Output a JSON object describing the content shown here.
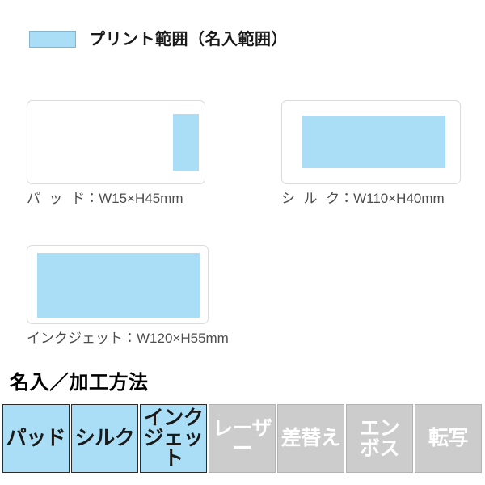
{
  "legend": {
    "swatch_color": "#aadef7",
    "label": "プリント範囲（名入範囲）"
  },
  "print_areas": [
    {
      "id": "pad",
      "method_jp": "パッド",
      "caption": "パッド：W15×H45mm",
      "dimension_text": "W15×H45mm",
      "width_mm": 15,
      "height_mm": 45
    },
    {
      "id": "silk",
      "method_jp": "シルク",
      "caption": "シルク：W110×H40mm",
      "dimension_text": "W110×H40mm",
      "width_mm": 110,
      "height_mm": 40
    },
    {
      "id": "inkjet",
      "method_jp": "インクジェット",
      "caption": "インクジェット：W120×H55mm",
      "dimension_text": "W120×H55mm",
      "width_mm": 120,
      "height_mm": 55
    }
  ],
  "methods": {
    "heading": "名入／加工方法",
    "active_color": "#aadef7",
    "disabled_color": "#cccccc",
    "items": [
      {
        "label": "パッド",
        "available": true,
        "lines": [
          "パッド"
        ]
      },
      {
        "label": "シルク",
        "available": true,
        "lines": [
          "シルク"
        ]
      },
      {
        "label": "インクジェット",
        "available": true,
        "lines": [
          "インク",
          "ジェット"
        ]
      },
      {
        "label": "レーザー",
        "available": false,
        "lines": [
          "レーザー"
        ]
      },
      {
        "label": "差替え",
        "available": false,
        "lines": [
          "差替え"
        ]
      },
      {
        "label": "エンボス",
        "available": false,
        "lines": [
          "エン",
          "ボス"
        ]
      },
      {
        "label": "転写",
        "available": false,
        "lines": [
          "転写"
        ]
      }
    ]
  }
}
